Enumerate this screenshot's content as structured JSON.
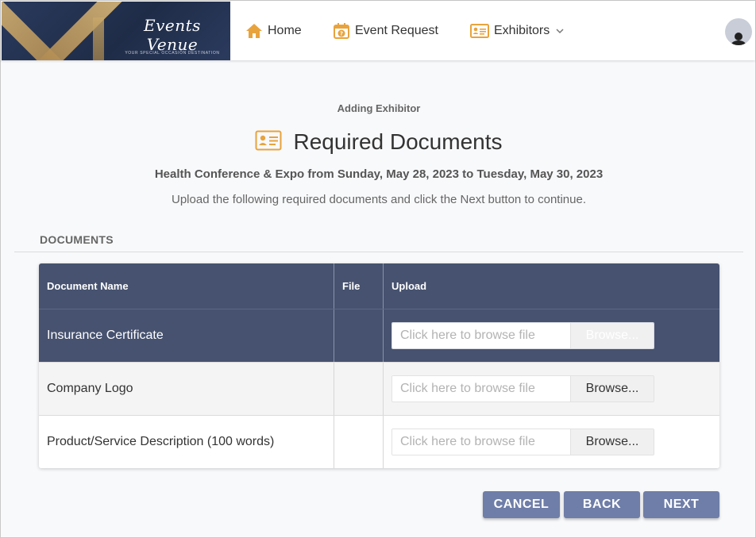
{
  "brand": {
    "name": "Events Venue",
    "tagline": "YOUR SPECIAL OCCASION DESTINATION"
  },
  "nav": {
    "home": "Home",
    "event_request": "Event Request",
    "exhibitors": "Exhibitors"
  },
  "page": {
    "subtitle": "Adding Exhibitor",
    "title": "Required Documents",
    "event_line": "Health Conference & Expo from Sunday, May 28, 2023 to Tuesday, May 30, 2023",
    "instruction": "Upload the following required documents and click the Next button to continue."
  },
  "documents": {
    "section_title": "DOCUMENTS",
    "headers": {
      "name": "Document Name",
      "file": "File",
      "upload": "Upload"
    },
    "rows": [
      {
        "name": "Insurance Certificate",
        "placeholder": "Click here to browse file",
        "browse": "Browse..."
      },
      {
        "name": "Company Logo",
        "placeholder": "Click here to browse file",
        "browse": "Browse..."
      },
      {
        "name": "Product/Service Description (100 words)",
        "placeholder": "Click here to browse file",
        "browse": "Browse..."
      }
    ]
  },
  "actions": {
    "cancel": "CANCEL",
    "back": "BACK",
    "next": "NEXT"
  },
  "colors": {
    "header_dark": "#46526f",
    "button": "#6f7ea8",
    "icon_accent": "#e8a33c"
  }
}
